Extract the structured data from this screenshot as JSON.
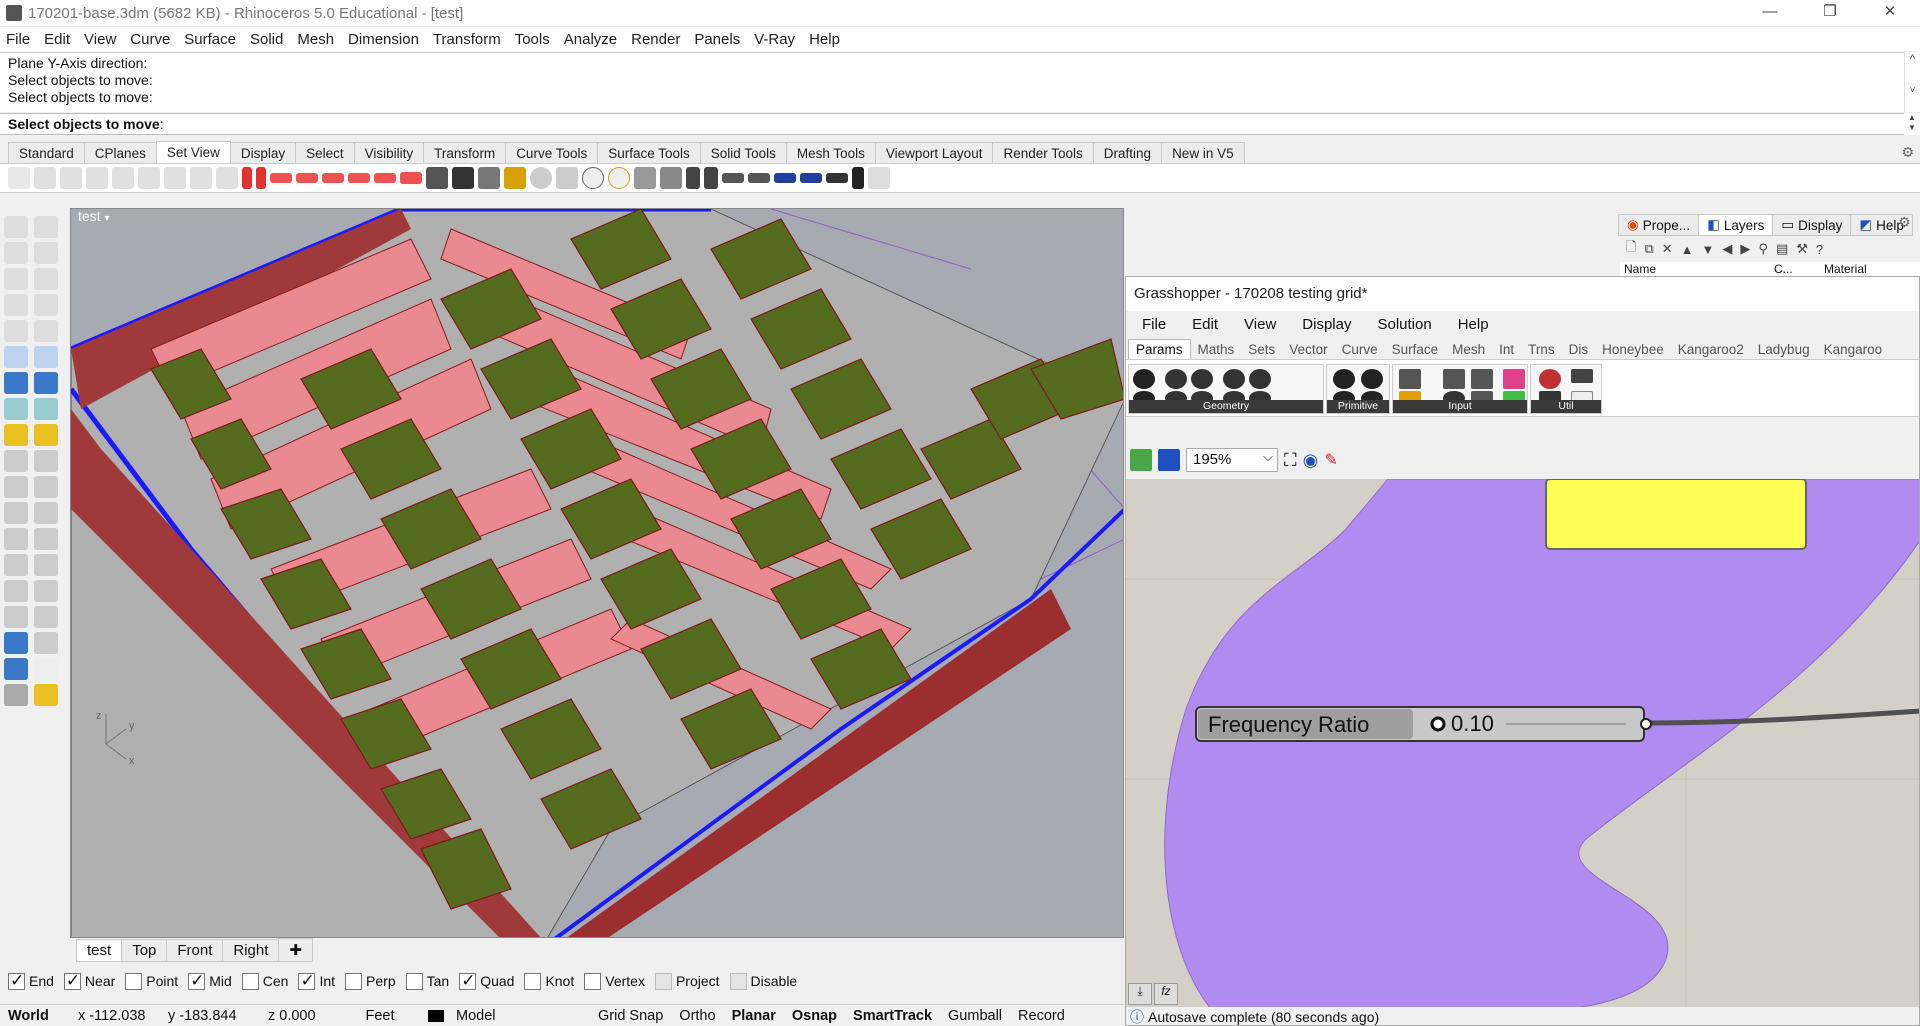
{
  "window": {
    "title": "170201-base.3dm (5682 KB) - Rhinoceros 5.0 Educational - [test]"
  },
  "menu": [
    "File",
    "Edit",
    "View",
    "Curve",
    "Surface",
    "Solid",
    "Mesh",
    "Dimension",
    "Transform",
    "Tools",
    "Analyze",
    "Render",
    "Panels",
    "V-Ray",
    "Help"
  ],
  "command": {
    "history": [
      "Plane Y-Axis direction:",
      "Select objects to move:",
      "Select objects to move:"
    ],
    "prompt": "Select objects to move"
  },
  "toolbar_tabs": [
    "Standard",
    "CPlanes",
    "Set View",
    "Display",
    "Select",
    "Visibility",
    "Transform",
    "Curve Tools",
    "Surface Tools",
    "Solid Tools",
    "Mesh Tools",
    "Viewport Layout",
    "Render Tools",
    "Drafting",
    "New in V5"
  ],
  "toolbar_active_tab": "Set View",
  "viewport": {
    "title": "test",
    "tabs": [
      "test",
      "Top",
      "Front",
      "Right"
    ],
    "axis_x": "x",
    "axis_y": "y",
    "axis_z": "z"
  },
  "osnap": [
    {
      "label": "End",
      "checked": true
    },
    {
      "label": "Near",
      "checked": true
    },
    {
      "label": "Point",
      "checked": false
    },
    {
      "label": "Mid",
      "checked": true
    },
    {
      "label": "Cen",
      "checked": false
    },
    {
      "label": "Int",
      "checked": true
    },
    {
      "label": "Perp",
      "checked": false
    },
    {
      "label": "Tan",
      "checked": false
    },
    {
      "label": "Quad",
      "checked": true
    },
    {
      "label": "Knot",
      "checked": false
    },
    {
      "label": "Vertex",
      "checked": false
    },
    {
      "label": "Project",
      "checked": false,
      "disabled": true
    },
    {
      "label": "Disable",
      "checked": false,
      "disabled": true
    }
  ],
  "status": {
    "cplane": "World",
    "x": "x -112.038",
    "y": "y -183.844",
    "z": "z 0.000",
    "units": "Feet",
    "layer": "Model",
    "grid_snap": "Grid Snap",
    "ortho": "Ortho",
    "planar": "Planar",
    "osnap": "Osnap",
    "smarttrack": "SmartTrack",
    "gumball": "Gumball",
    "record": "Record"
  },
  "right_panel": {
    "tabs": [
      "Prope...",
      "Layers",
      "Display",
      "Help"
    ],
    "columns": [
      "Name",
      "C...",
      "Material"
    ]
  },
  "grasshopper": {
    "title": "Grasshopper - 170208 testing grid*",
    "menu": [
      "File",
      "Edit",
      "View",
      "Display",
      "Solution",
      "Help"
    ],
    "tabs": [
      "Params",
      "Maths",
      "Sets",
      "Vector",
      "Curve",
      "Surface",
      "Mesh",
      "Int",
      "Trns",
      "Dis",
      "Honeybee",
      "Kangaroo2",
      "Ladybug",
      "Kangaroo"
    ],
    "groups": [
      "Geometry",
      "Primitive",
      "Input",
      "Util"
    ],
    "zoom": "195%",
    "slider": {
      "name": "Frequency Ratio",
      "value": "0.10"
    },
    "status": "Autosave complete (80 seconds ago)"
  },
  "colors": {
    "panel_green": "#556b1e",
    "wall_pink": "#e88a90",
    "wall_red": "#8b1a1a",
    "edge_blue": "#1a1aff",
    "gh_purple": "#b18cf0",
    "gh_yellow": "#ffff55"
  }
}
